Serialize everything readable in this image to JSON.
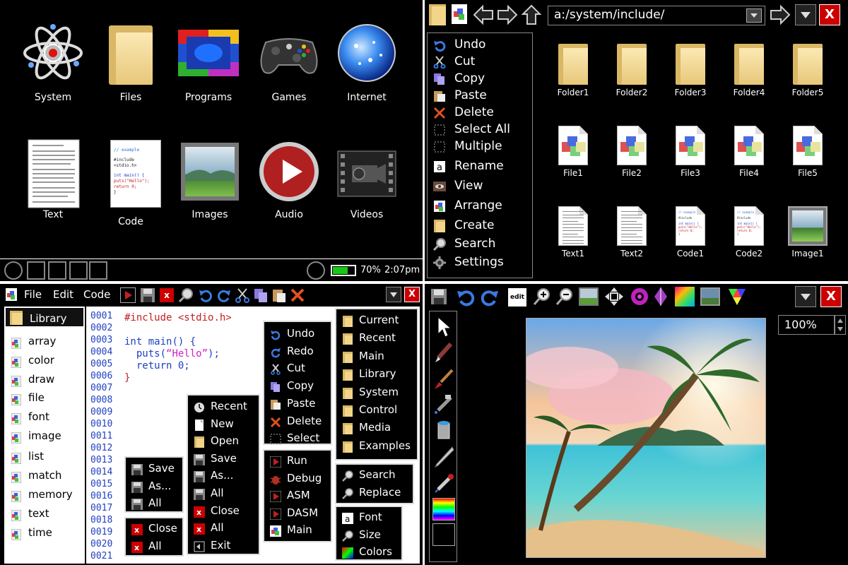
{
  "launcher": {
    "apps": [
      {
        "label": "System",
        "icon": "atom-icon"
      },
      {
        "label": "Files",
        "icon": "folder-icon"
      },
      {
        "label": "Programs",
        "icon": "programs-icon"
      },
      {
        "label": "Games",
        "icon": "gamepad-icon"
      },
      {
        "label": "Internet",
        "icon": "globe-icon"
      },
      {
        "label": "Text",
        "icon": "text-document-icon"
      },
      {
        "label": "Code",
        "icon": "code-document-icon"
      },
      {
        "label": "Images",
        "icon": "image-icon"
      },
      {
        "label": "Audio",
        "icon": "play-icon"
      },
      {
        "label": "Videos",
        "icon": "video-camera-icon"
      }
    ],
    "code_icon_text": [
      "// example",
      "#include <stdio.h>",
      "int main() {",
      "  puts(\"Hello\");",
      "  return 0;",
      "}"
    ],
    "battery_level": 0.7,
    "battery_text": "70%",
    "clock": "2:07pm"
  },
  "file_manager": {
    "address": "a:/system/include/",
    "close_label": "X",
    "menu": [
      "Undo",
      "Cut",
      "Copy",
      "Paste",
      "Delete",
      "Select All",
      "Multiple",
      "Rename",
      "View",
      "Arrange",
      "Create",
      "Search",
      "Settings"
    ],
    "folders": [
      "Folder1",
      "Folder2",
      "Folder3",
      "Folder4",
      "Folder5"
    ],
    "files": [
      "File1",
      "File2",
      "File3",
      "File4",
      "File5"
    ],
    "documents": [
      "Text1",
      "Text2",
      "Code1",
      "Code2",
      "Image1"
    ]
  },
  "editor": {
    "menu": [
      "File",
      "Edit",
      "Code"
    ],
    "close_label": "X",
    "library_title": "Library",
    "library_items": [
      "array",
      "color",
      "draw",
      "file",
      "font",
      "image",
      "list",
      "match",
      "memory",
      "text",
      "time"
    ],
    "line_numbers": [
      "0001",
      "0002",
      "0003",
      "0004",
      "0005",
      "0006",
      "0007",
      "0008",
      "0009",
      "0010",
      "0011",
      "0012",
      "0013",
      "0014",
      "0015",
      "0016",
      "0017",
      "0018",
      "0019",
      "0020",
      "0021"
    ],
    "code": {
      "include_kw": "#include",
      "include_file": "<stdio.h>",
      "int_kw": "int",
      "main_sig": " main() {",
      "puts_call": "  puts(",
      "hello_str": "“Hello”",
      "puts_end": ");",
      "return_kw": "  return",
      "return_val": " 0;",
      "close_brace": "}"
    },
    "edit_menu": [
      "Undo",
      "Redo",
      "Cut",
      "Copy",
      "Paste",
      "Delete",
      "Select"
    ],
    "file_menu": [
      "Recent",
      "New",
      "Open",
      "Save",
      "As...",
      "All",
      "Close",
      "All",
      "Exit"
    ],
    "save_menu": [
      "Save",
      "As...",
      "All"
    ],
    "close_menu": [
      "Close",
      "All"
    ],
    "folders_menu": [
      "Current",
      "Recent",
      "Main",
      "Library",
      "System",
      "Control",
      "Media",
      "Examples"
    ],
    "run_menu": [
      "Run",
      "Debug",
      "ASM",
      "DASM",
      "Main"
    ],
    "search_menu": [
      "Search",
      "Replace"
    ],
    "font_menu": [
      "Font",
      "Size",
      "Colors"
    ]
  },
  "paint": {
    "edit_label": "edit",
    "close_label": "X",
    "zoom": "100%",
    "tools": [
      "pointer-icon",
      "pen-icon",
      "brush-icon",
      "airbrush-icon",
      "bucket-icon",
      "knife-icon",
      "dropper-icon",
      "palette-icon",
      "color-swatch-icon"
    ]
  }
}
